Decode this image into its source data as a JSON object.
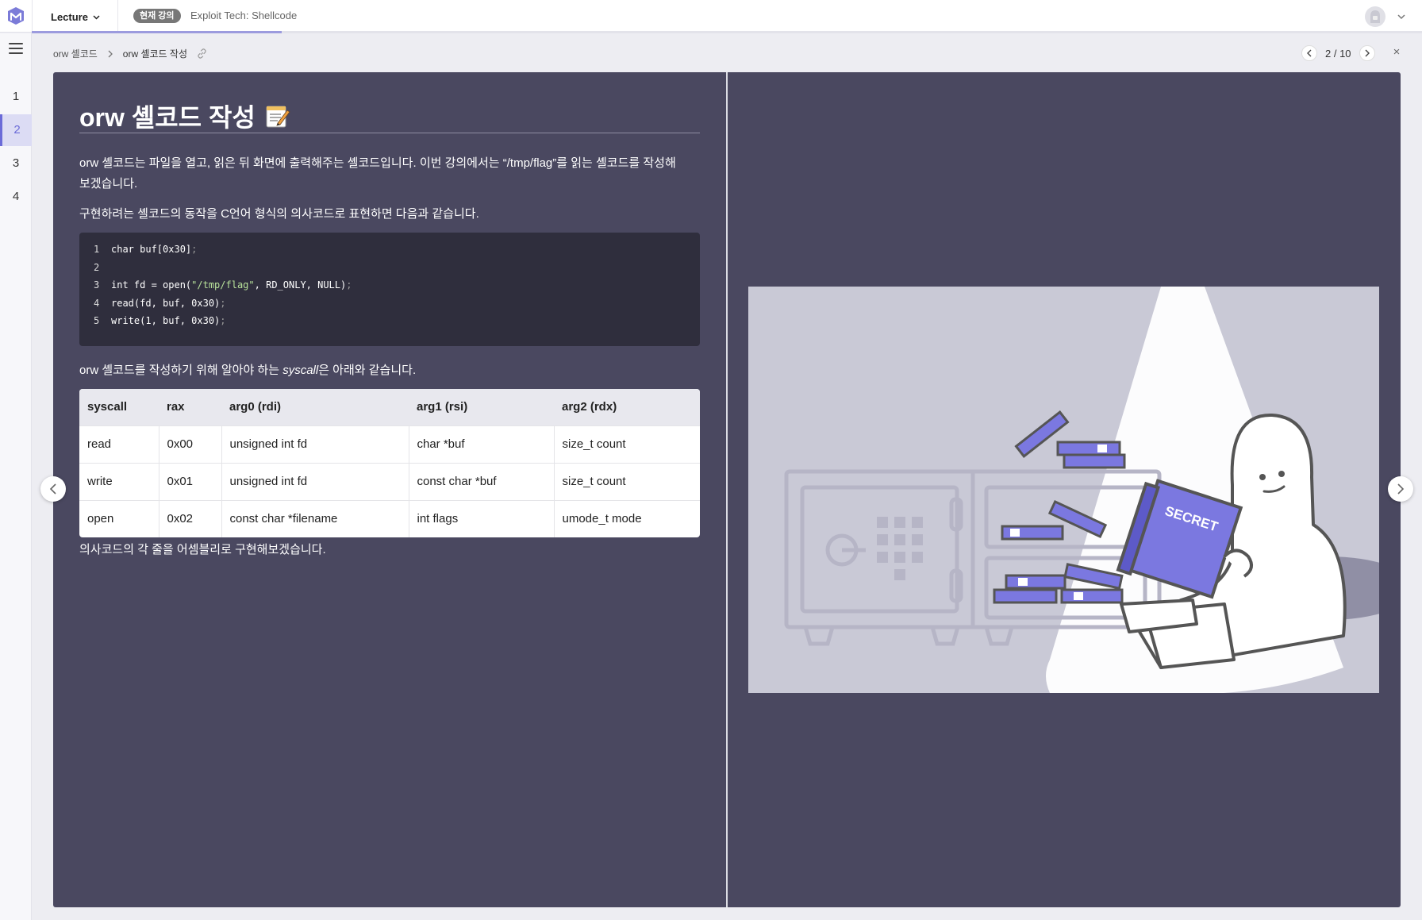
{
  "header": {
    "lecture_label": "Lecture",
    "current_badge": "현재 강의",
    "current_title": "Exploit Tech: Shellcode",
    "progress": 0.18
  },
  "rail": {
    "items": [
      "1",
      "2",
      "3",
      "4"
    ],
    "active_index": 1
  },
  "breadcrumb": {
    "parent": "orw 셸코드",
    "current": "orw 셸코드 작성"
  },
  "pager": {
    "text": "2 / 10",
    "close": "×"
  },
  "slide": {
    "title": "orw 셸코드 작성",
    "title_icon": "memo-icon",
    "paragraph1": "orw 셸코드는 파일을 열고, 읽은 뒤 화면에 출력해주는 셸코드입니다. 이번 강의에서는 “/tmp/flag”를 읽는 셸코드를 작성해보겠습니다.",
    "paragraph2": "구현하려는 셸코드의 동작을 C언어 형식의 의사코드로 표현하면 다음과 같습니다.",
    "code_lines": [
      {
        "n": "1",
        "pre": "char buf[0x30]",
        "str": "",
        "post": "",
        "semi": ";"
      },
      {
        "n": "2",
        "pre": "",
        "str": "",
        "post": "",
        "semi": ""
      },
      {
        "n": "3",
        "pre": "int fd = open(",
        "str": "\"/tmp/flag\"",
        "post": ", RD_ONLY, NULL)",
        "semi": ";"
      },
      {
        "n": "4",
        "pre": "read(fd, buf, 0x30)",
        "str": "",
        "post": "",
        "semi": ";"
      },
      {
        "n": "5",
        "pre": "write(1, buf, 0x30)",
        "str": "",
        "post": "",
        "semi": ";"
      }
    ],
    "paragraph3_before": "orw 셸코드를 작성하기 위해 알아야 하는 ",
    "paragraph3_italic": "syscall",
    "paragraph3_after": "은 아래와 같습니다.",
    "table": {
      "headers": [
        "syscall",
        "rax",
        "arg0 (rdi)",
        "arg1 (rsi)",
        "arg2 (rdx)"
      ],
      "rows": [
        [
          "read",
          "0x00",
          "unsigned int fd",
          "char *buf",
          "size_t count"
        ],
        [
          "write",
          "0x01",
          "unsigned int fd",
          "const char *buf",
          "size_t count"
        ],
        [
          "open",
          "0x02",
          "const char *filename",
          "int flags",
          "umode_t mode"
        ]
      ]
    },
    "paragraph4": "의사코드의 각 줄을 어셈블리로 구현해보겠습니다.",
    "illustration": {
      "book_label": "SECRET",
      "accent": "#7b78e0",
      "background": "#c9c9d6"
    }
  }
}
